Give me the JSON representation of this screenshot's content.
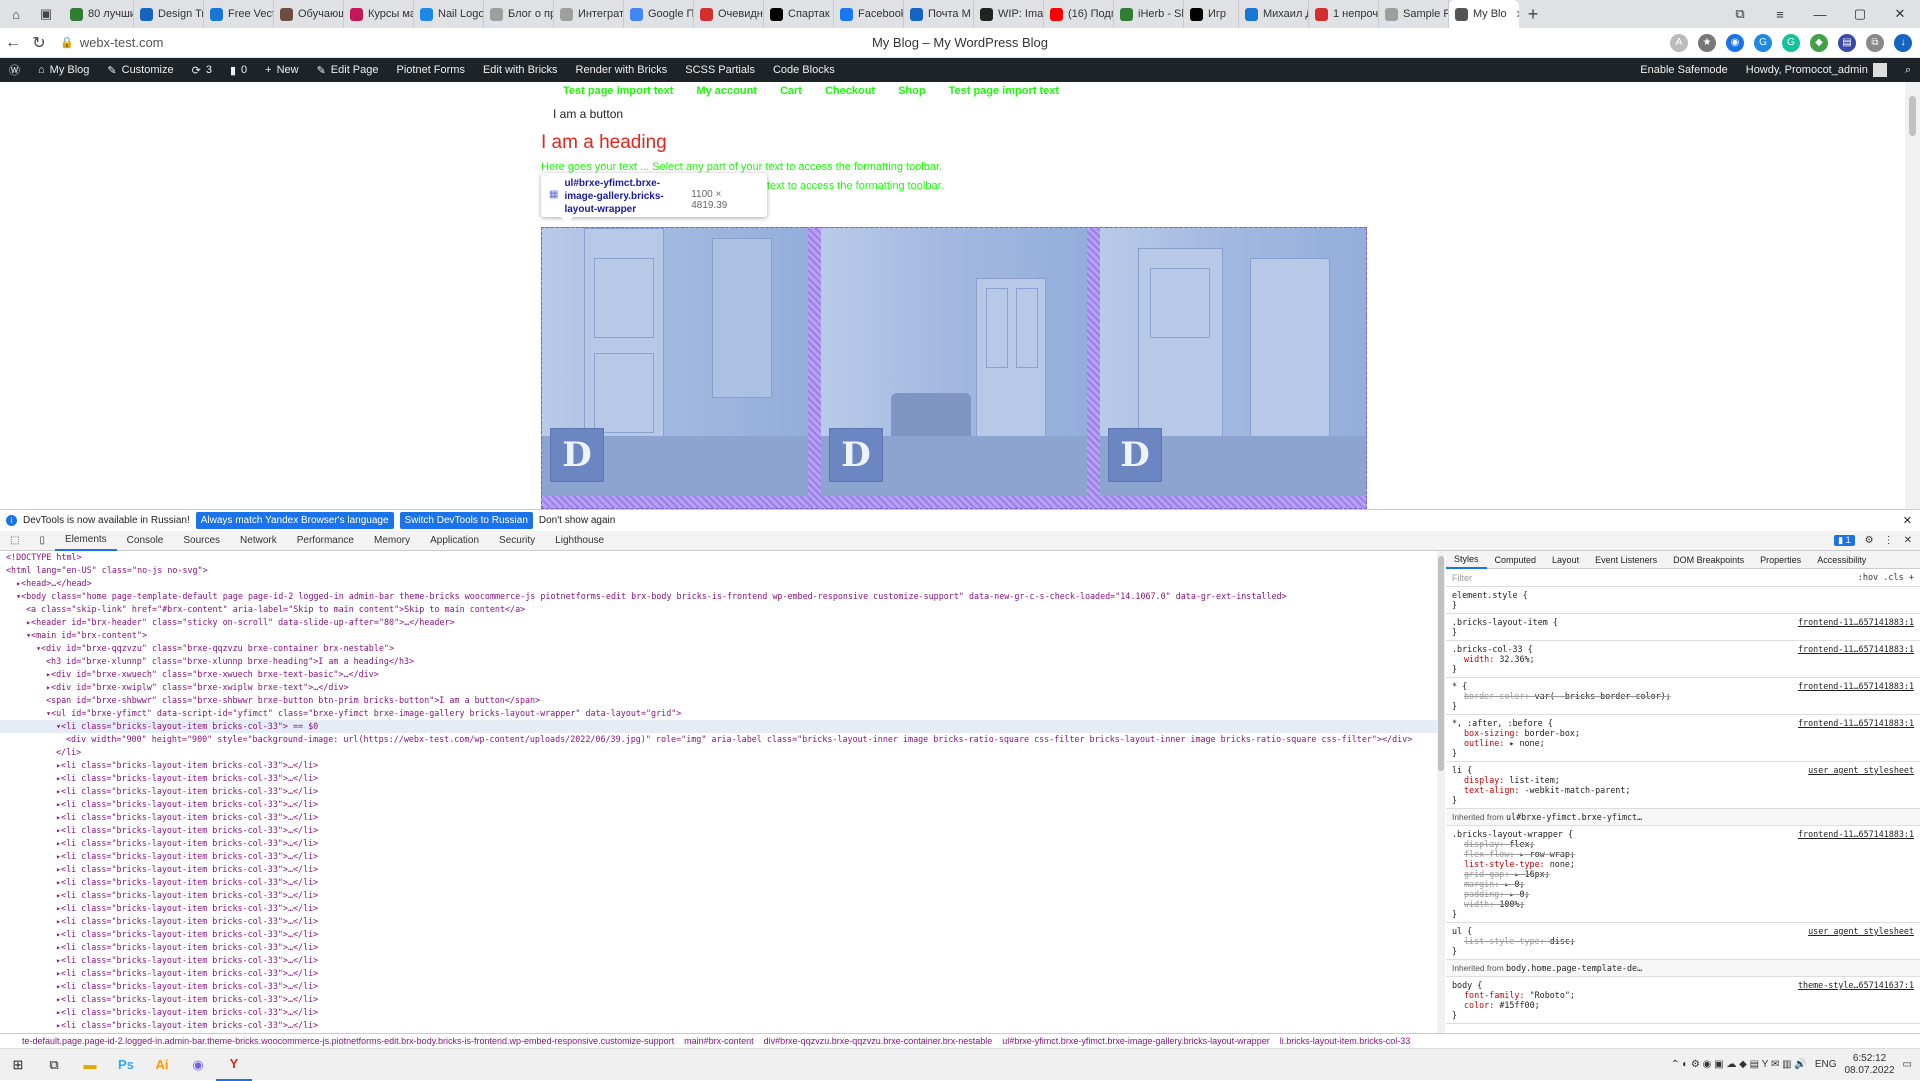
{
  "tabs": [
    {
      "label": "80 лучши",
      "color": "#2e7d32"
    },
    {
      "label": "Design Tr",
      "color": "#1565c0"
    },
    {
      "label": "Free Vect",
      "color": "#1976d2"
    },
    {
      "label": "Обучающ",
      "color": "#6d4c41"
    },
    {
      "label": "Курсы ма",
      "color": "#c2185b"
    },
    {
      "label": "Nail Logo",
      "color": "#1e88e5"
    },
    {
      "label": "Блог о пр",
      "color": "#9e9e9e"
    },
    {
      "label": "Интеграт",
      "color": "#9e9e9e"
    },
    {
      "label": "Google П",
      "color": "#4285f4"
    },
    {
      "label": "Очевидн",
      "color": "#d32f2f"
    },
    {
      "label": "Спартак",
      "color": "#000000"
    },
    {
      "label": "Facebook",
      "color": "#1877f2"
    },
    {
      "label": "Почта М",
      "color": "#1565c0"
    },
    {
      "label": "WIP: Imag",
      "color": "#222222"
    },
    {
      "label": "(16) Подп",
      "color": "#ff0000"
    },
    {
      "label": "iHerb - Sh",
      "color": "#2e7d32"
    },
    {
      "label": "Игр",
      "color": "#000000"
    },
    {
      "label": "Михаил Д",
      "color": "#1976d2"
    },
    {
      "label": "1 непроч",
      "color": "#d32f2f"
    },
    {
      "label": "Sample P",
      "color": "#9e9e9e"
    },
    {
      "label": "My Blo",
      "color": "#555555",
      "active": true
    }
  ],
  "address": {
    "url": "webx-test.com",
    "page_title": "My Blog – My WordPress Blog"
  },
  "wpbar": {
    "items": [
      "My Blog",
      "Customize",
      "3",
      "0",
      "New",
      "Edit Page",
      "Piotnet Forms",
      "Edit with Bricks",
      "Render with Bricks",
      "SCSS Partials",
      "Code Blocks"
    ],
    "safemode": "Enable Safemode",
    "howdy": "Howdy, Promocot_admin"
  },
  "page": {
    "menu": [
      "Test page import text",
      "My account",
      "Cart",
      "Checkout",
      "Shop",
      "Test page import text"
    ],
    "button_text": "I am a button",
    "heading": "I am a heading",
    "body_text": "Here goes your text ... Select any part of your text to access the formatting toolbar.",
    "body_text_2": "text to access the formatting toolbar.",
    "tooltip_selector": "ul#brxe-yfimct.brxe-image-gallery.bricks-layout-wrapper",
    "tooltip_dims": "1100 × 4819.39",
    "logo_letter": "D",
    "accent_color": "#15ff00",
    "heading_color": "#e8231a"
  },
  "infobar": {
    "message": "DevTools is now available in Russian!",
    "btn1": "Always match Yandex Browser's language",
    "btn2": "Switch DevTools to Russian",
    "btn3": "Don't show again"
  },
  "devtools": {
    "tabs": [
      "Elements",
      "Console",
      "Sources",
      "Network",
      "Performance",
      "Memory",
      "Application",
      "Security",
      "Lighthouse"
    ],
    "issues_count": "1",
    "dom_lines": [
      {
        "indent": 0,
        "text": "<!DOCTYPE html>",
        "comment": true
      },
      {
        "indent": 0,
        "text": "<html lang=\"en-US\" class=\"no-js no-svg\">"
      },
      {
        "indent": 1,
        "text": "▸<head>…</head>"
      },
      {
        "indent": 1,
        "text": "▾<body class=\"home page-template-default page page-id-2 logged-in admin-bar theme-bricks woocommerce-js piotnetforms-edit brx-body bricks-is-frontend wp-embed-responsive customize-support\" data-new-gr-c-s-check-loaded=\"14.1067.0\" data-gr-ext-installed>"
      },
      {
        "indent": 2,
        "text": "<a class=\"skip-link\" href=\"#brx-content\" aria-label=\"Skip to main content\">Skip to main content</a>"
      },
      {
        "indent": 2,
        "text": "▸<header id=\"brx-header\" class=\"sticky on-scroll\" data-slide-up-after=\"80\">…</header>"
      },
      {
        "indent": 2,
        "text": "▾<main id=\"brx-content\">"
      },
      {
        "indent": 3,
        "text": "▾<div id=\"brxe-qqzvzu\" class=\"brxe-qqzvzu brxe-container brx-nestable\">"
      },
      {
        "indent": 4,
        "text": "<h3 id=\"brxe-xlunnp\" class=\"brxe-xlunnp brxe-heading\">I am a heading</h3>"
      },
      {
        "indent": 4,
        "text": "▸<div id=\"brxe-xwuech\" class=\"brxe-xwuech brxe-text-basic\">…</div>"
      },
      {
        "indent": 4,
        "text": "▸<div id=\"brxe-xwiplw\" class=\"brxe-xwiplw brxe-text\">…</div>"
      },
      {
        "indent": 4,
        "text": "<span id=\"brxe-shbwwr\" class=\"brxe-shbwwr brxe-button btn-prim bricks-button\">I am a button</span>"
      },
      {
        "indent": 4,
        "text": "▾<ul id=\"brxe-yfimct\" data-script-id=\"yfimct\" class=\"brxe-yfimct brxe-image-gallery bricks-layout-wrapper\" data-layout=\"grid\">"
      },
      {
        "indent": 5,
        "text": "▾<li class=\"bricks-layout-item bricks-col-33\"> == $0",
        "selected": true
      },
      {
        "indent": 6,
        "text": "<div width=\"900\" height=\"900\" style=\"background-image: url(https://webx-test.com/wp-content/uploads/2022/06/39.jpg)\" role=\"img\" aria-label class=\"bricks-layout-inner image bricks-ratio-square css-filter bricks-layout-inner image bricks-ratio-square css-filter\"></div>"
      },
      {
        "indent": 5,
        "text": "</li>"
      },
      {
        "indent": 5,
        "text": "▸<li class=\"bricks-layout-item bricks-col-33\">…</li>"
      },
      {
        "indent": 5,
        "text": "▸<li class=\"bricks-layout-item bricks-col-33\">…</li>"
      },
      {
        "indent": 5,
        "text": "▸<li class=\"bricks-layout-item bricks-col-33\">…</li>"
      },
      {
        "indent": 5,
        "text": "▸<li class=\"bricks-layout-item bricks-col-33\">…</li>"
      },
      {
        "indent": 5,
        "text": "▸<li class=\"bricks-layout-item bricks-col-33\">…</li>"
      },
      {
        "indent": 5,
        "text": "▸<li class=\"bricks-layout-item bricks-col-33\">…</li>"
      },
      {
        "indent": 5,
        "text": "▸<li class=\"bricks-layout-item bricks-col-33\">…</li>"
      },
      {
        "indent": 5,
        "text": "▸<li class=\"bricks-layout-item bricks-col-33\">…</li>"
      },
      {
        "indent": 5,
        "text": "▸<li class=\"bricks-layout-item bricks-col-33\">…</li>"
      },
      {
        "indent": 5,
        "text": "▸<li class=\"bricks-layout-item bricks-col-33\">…</li>"
      },
      {
        "indent": 5,
        "text": "▸<li class=\"bricks-layout-item bricks-col-33\">…</li>"
      },
      {
        "indent": 5,
        "text": "▸<li class=\"bricks-layout-item bricks-col-33\">…</li>"
      },
      {
        "indent": 5,
        "text": "▸<li class=\"bricks-layout-item bricks-col-33\">…</li>"
      },
      {
        "indent": 5,
        "text": "▸<li class=\"bricks-layout-item bricks-col-33\">…</li>"
      },
      {
        "indent": 5,
        "text": "▸<li class=\"bricks-layout-item bricks-col-33\">…</li>"
      },
      {
        "indent": 5,
        "text": "▸<li class=\"bricks-layout-item bricks-col-33\">…</li>"
      },
      {
        "indent": 5,
        "text": "▸<li class=\"bricks-layout-item bricks-col-33\">…</li>"
      },
      {
        "indent": 5,
        "text": "▸<li class=\"bricks-layout-item bricks-col-33\">…</li>"
      },
      {
        "indent": 5,
        "text": "▸<li class=\"bricks-layout-item bricks-col-33\">…</li>"
      },
      {
        "indent": 5,
        "text": "▸<li class=\"bricks-layout-item bricks-col-33\">…</li>"
      },
      {
        "indent": 5,
        "text": "▸<li class=\"bricks-layout-item bricks-col-33\">…</li>"
      }
    ],
    "styles_tabs": [
      "Styles",
      "Computed",
      "Layout",
      "Event Listeners",
      "DOM Breakpoints",
      "Properties",
      "Accessibility"
    ],
    "filter_placeholder": "Filter",
    "hov": ":hov  .cls  +",
    "rules": [
      {
        "sel": "element.style {",
        "props": [],
        "src": ""
      },
      {
        "sel": ".bricks-layout-item {",
        "props": [],
        "src": "frontend-11…657141883:1"
      },
      {
        "sel": ".bricks-col-33 {",
        "props": [
          {
            "p": "width",
            "v": "32.36%;"
          }
        ],
        "src": "frontend-11…657141883:1"
      },
      {
        "sel": "* {",
        "props": [
          {
            "p": "border-color",
            "v": "var(--bricks-border-color);",
            "struck": true
          }
        ],
        "src": "frontend-11…657141883:1"
      },
      {
        "sel": "*, :after, :before {",
        "props": [
          {
            "p": "box-sizing",
            "v": "border-box;"
          },
          {
            "p": "outline",
            "v": "▸ none;"
          }
        ],
        "src": "frontend-11…657141883:1"
      },
      {
        "sel": "li {",
        "props": [
          {
            "p": "display",
            "v": "list-item;"
          },
          {
            "p": "text-align",
            "v": "-webkit-match-parent;"
          }
        ],
        "src": "user agent stylesheet"
      }
    ],
    "inherited_1": "ul#brxe-yfimct.brxe-yfimct…",
    "rules2": [
      {
        "sel": ".bricks-layout-wrapper {",
        "props": [
          {
            "p": "display",
            "v": "flex;",
            "struck": true
          },
          {
            "p": "flex-flow",
            "v": "▸ row wrap;",
            "struck": true
          },
          {
            "p": "list-style-type",
            "v": "none;"
          },
          {
            "p": "grid-gap",
            "v": "▸ 16px;",
            "struck": true
          },
          {
            "p": "margin",
            "v": "▸ 0;",
            "struck": true
          },
          {
            "p": "padding",
            "v": "▸ 0;",
            "struck": true
          },
          {
            "p": "width",
            "v": "100%;",
            "struck": true
          }
        ],
        "src": "frontend-11…657141883:1"
      },
      {
        "sel": "ul {",
        "props": [
          {
            "p": "list-style-type",
            "v": "disc;",
            "struck": true
          }
        ],
        "src": "user agent stylesheet"
      }
    ],
    "inherited_2": "body.home.page-template-de…",
    "rules3": [
      {
        "sel": "body {",
        "props": [
          {
            "p": "font-family",
            "v": "\"Roboto\";"
          },
          {
            "p": "color",
            "v": "#15ff00;"
          }
        ],
        "src": "theme-style…657141637:1"
      }
    ]
  },
  "breadcrumb": [
    "te-default.page.page-id-2.logged-in.admin-bar.theme-bricks.woocommerce-js.piotnetforms-edit.brx-body.bricks-is-frontend.wp-embed-responsive.customize-support",
    "main#brx-content",
    "div#brxe-qqzvzu.brxe-qqzvzu.brxe-container.brx-nestable",
    "ul#brxe-yfimct.brxe-yfimct.brxe-image-gallery.bricks-layout-wrapper",
    "li.bricks-layout-item.bricks-col-33"
  ],
  "taskbar": {
    "time": "6:52:12",
    "date": "08.07.2022",
    "lang": "ENG"
  }
}
